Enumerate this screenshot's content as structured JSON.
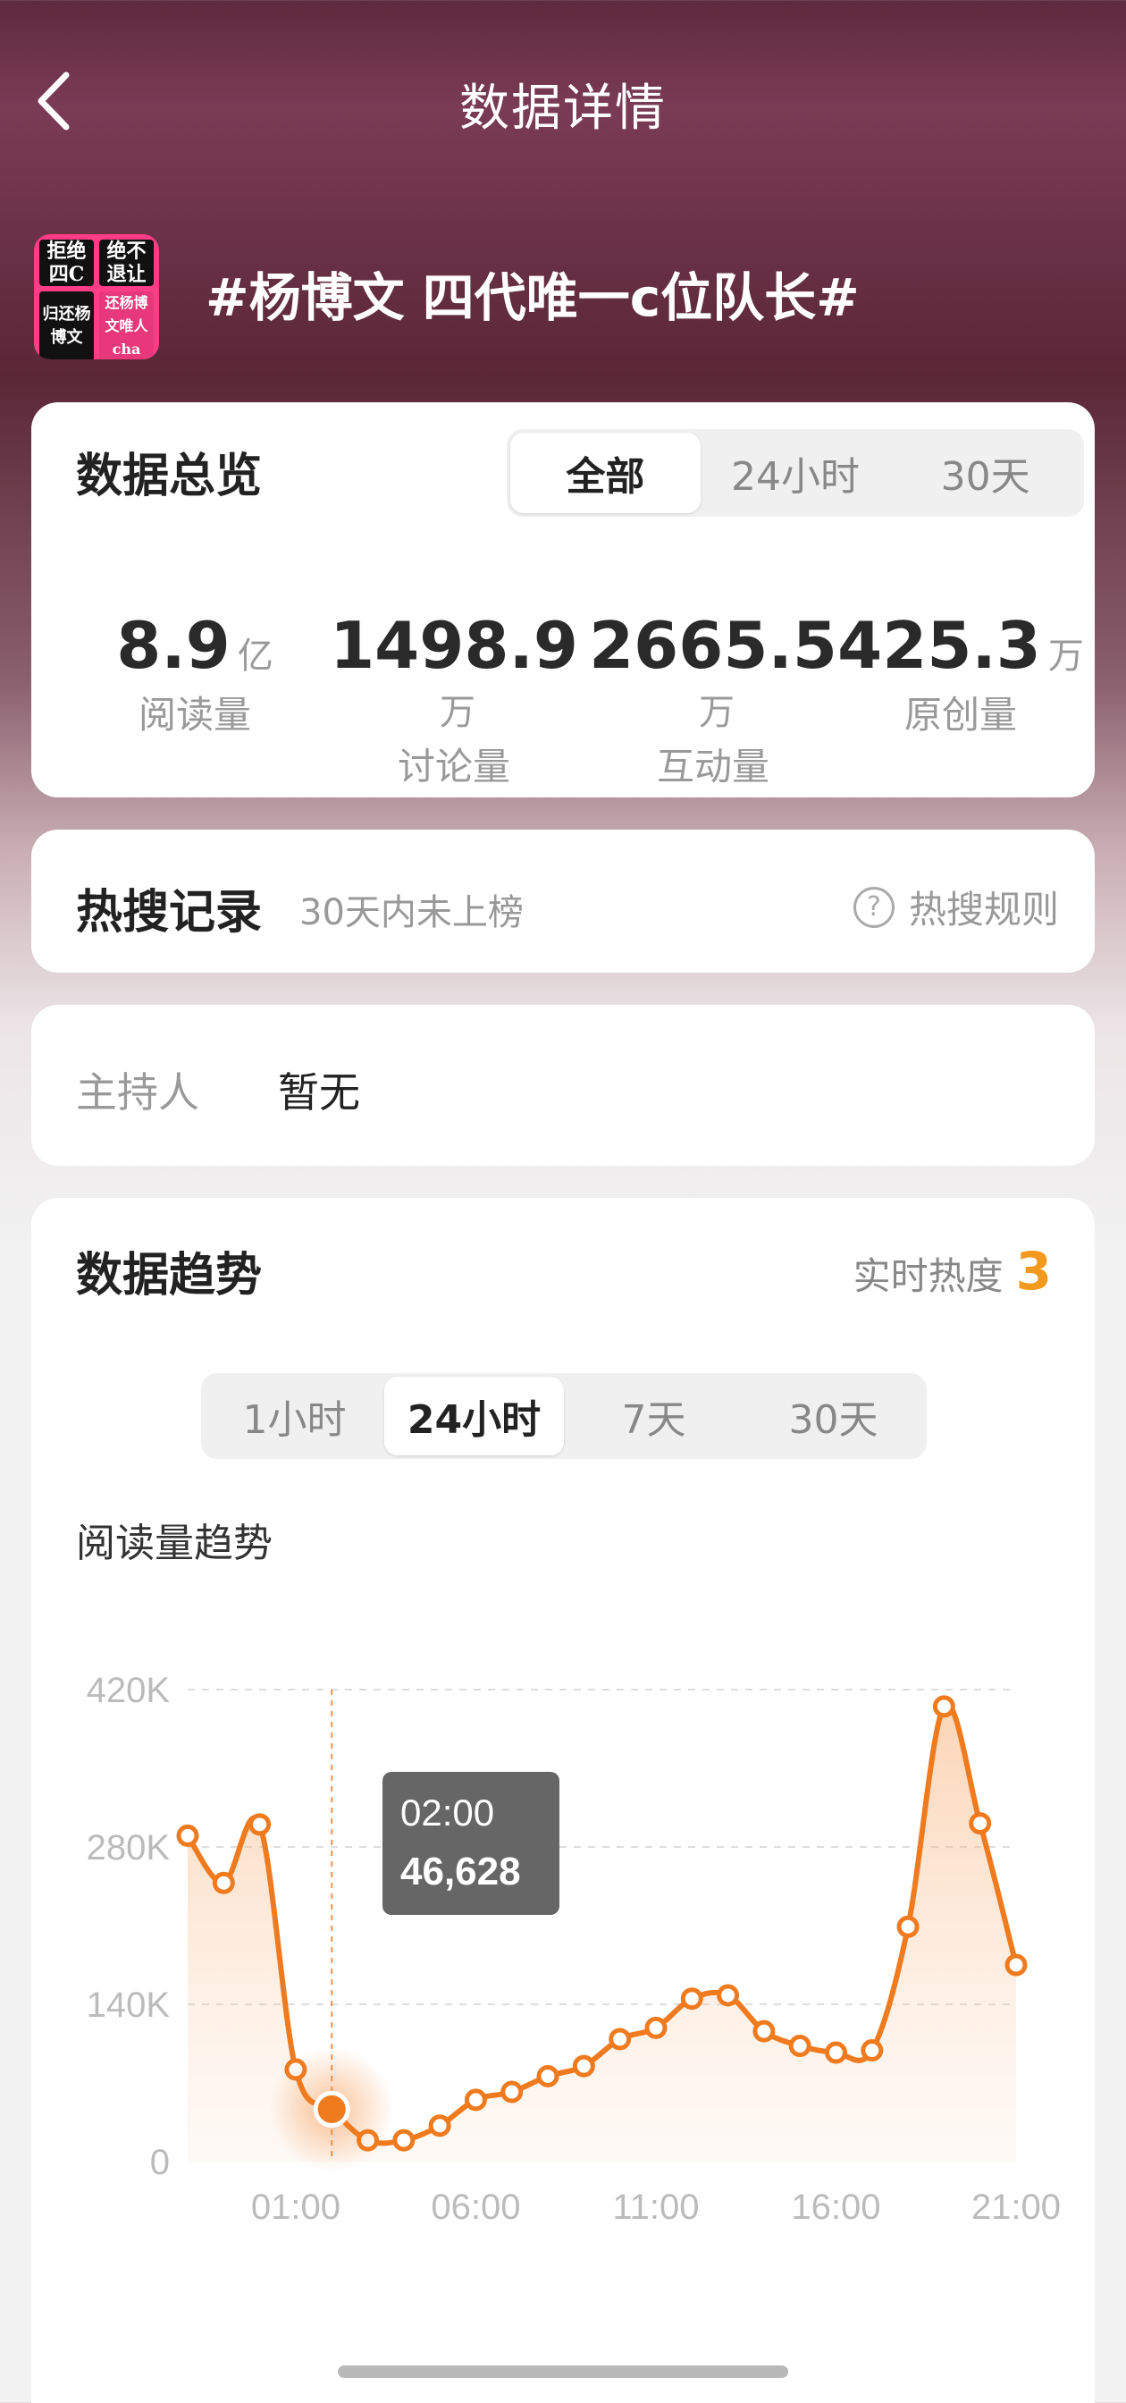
{
  "header": {
    "title": "数据详情",
    "back_icon": "chevron-left-icon"
  },
  "topic": {
    "title": "#杨博文 四代唯一c位队长#",
    "thumbnail_texts": [
      "拒绝四C",
      "绝不退让",
      "归还杨博文",
      "还杨博文唯人cha"
    ]
  },
  "overview": {
    "title": "数据总览",
    "tabs": [
      {
        "label": "全部",
        "active": true
      },
      {
        "label": "24小时",
        "active": false
      },
      {
        "label": "30天",
        "active": false
      }
    ],
    "metrics": [
      {
        "value": "8.9",
        "unit": "亿",
        "label": "阅读量"
      },
      {
        "value": "1498.9",
        "unit": "万",
        "label": "讨论量"
      },
      {
        "value": "2665.5",
        "unit": "万",
        "label": "互动量"
      },
      {
        "value": "425.3",
        "unit": "万",
        "label": "原创量"
      }
    ]
  },
  "hotsearch": {
    "title": "热搜记录",
    "status": "30天内未上榜",
    "rules_label": "热搜规则",
    "rules_icon": "question-circle-icon"
  },
  "host": {
    "label": "主持人",
    "value": "暂无"
  },
  "trend": {
    "title": "数据趋势",
    "realtime_label": "实时热度",
    "realtime_value": "3",
    "tabs": [
      {
        "label": "1小时",
        "active": false
      },
      {
        "label": "24小时",
        "active": true
      },
      {
        "label": "7天",
        "active": false
      },
      {
        "label": "30天",
        "active": false
      }
    ],
    "chart_subtitle": "阅读量趋势"
  },
  "colors": {
    "accent_orange": "#f07a1e",
    "realtime_orange": "#f39a1e",
    "tooltip_bg": "#666666"
  },
  "chart_data": {
    "type": "area",
    "title": "阅读量趋势",
    "xlabel": "",
    "ylabel": "",
    "x": [
      "22:00",
      "23:00",
      "00:00",
      "01:00",
      "02:00",
      "03:00",
      "04:00",
      "05:00",
      "06:00",
      "07:00",
      "08:00",
      "09:00",
      "10:00",
      "11:00",
      "12:00",
      "13:00",
      "14:00",
      "15:00",
      "16:00",
      "17:00",
      "18:00",
      "19:00",
      "20:00",
      "21:00"
    ],
    "x_tick_labels": [
      "01:00",
      "06:00",
      "11:00",
      "16:00",
      "21:00"
    ],
    "y_tick_labels": [
      "420K",
      "280K",
      "140K",
      "0"
    ],
    "ylim": [
      0,
      420000
    ],
    "grid": true,
    "series": [
      {
        "values": [
          290000,
          248000,
          300000,
          82000,
          46628,
          19000,
          19000,
          32000,
          55000,
          62000,
          76000,
          85000,
          109000,
          119000,
          145000,
          148000,
          116000,
          103000,
          97000,
          99000,
          209000,
          405000,
          301000,
          175000
        ]
      }
    ],
    "tooltip": {
      "x": "02:00",
      "value": "46,628"
    },
    "highlight_index": 4
  }
}
